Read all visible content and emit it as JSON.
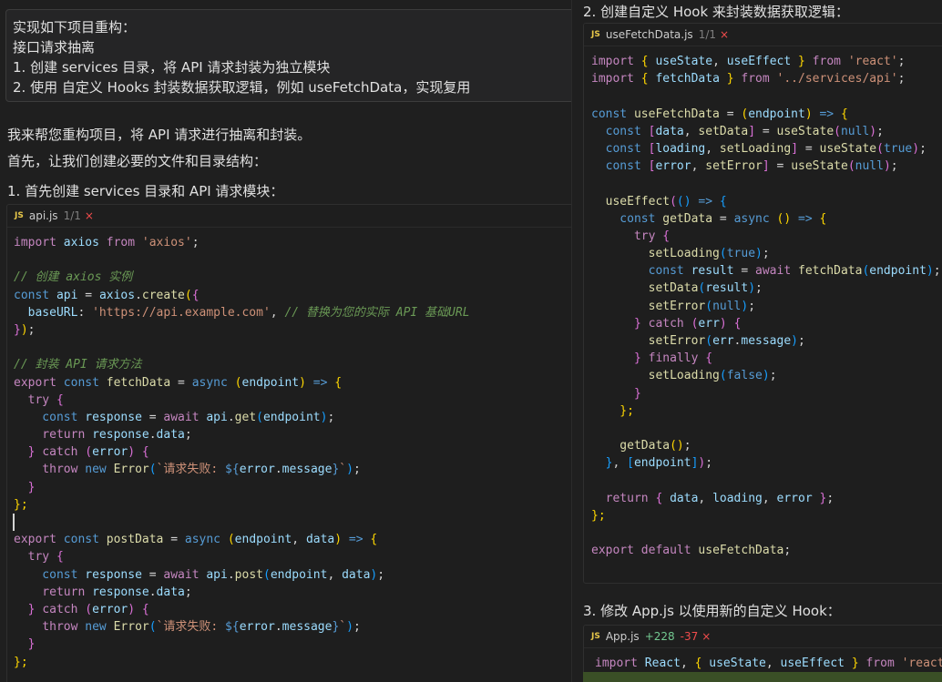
{
  "prompt": {
    "lines": [
      "实现如下项目重构：",
      "接口请求抽离",
      "1. 创建 services 目录，将 API 请求封装为独立模块",
      "2. 使用 自定义 Hooks 封装数据获取逻辑，例如 useFetchData，实现复用"
    ]
  },
  "answer": {
    "intro1": "我来帮您重构项目，将 API 请求进行抽离和封装。",
    "intro2": "首先，让我们创建必要的文件和目录结构：",
    "step1": "1. 首先创建 services 目录和 API 请求模块：",
    "step2": "2. 创建自定义 Hook 来封装数据获取逻辑：",
    "step3": "3. 修改 App.js 以使用新的自定义 Hook："
  },
  "files": {
    "api": {
      "icon": "JS",
      "name": "api.js",
      "count": "1/1",
      "close": "×"
    },
    "hook": {
      "icon": "JS",
      "name": "useFetchData.js",
      "count": "1/1",
      "close": "×"
    },
    "app": {
      "icon": "JS",
      "name": "App.js",
      "added": "+228",
      "removed": "-37",
      "close": "×"
    }
  },
  "colors": {
    "keyword": "#c586c0",
    "decl": "#569cd6",
    "variable": "#9cdcfe",
    "function": "#dcdcaa",
    "string": "#ce9178",
    "comment": "#6a9955",
    "plain": "#d4d4d4",
    "bracket1": "#ffd700",
    "bracket2": "#da70d6",
    "bracket3": "#179fff",
    "js_icon": "#e8c84a",
    "added": "#73c991",
    "removed": "#f14c4c"
  },
  "code_api": [
    [
      [
        "import ",
        "keyword"
      ],
      [
        "axios ",
        "variable"
      ],
      [
        "from ",
        "keyword"
      ],
      [
        "'axios'",
        "string"
      ],
      [
        ";",
        "plain"
      ]
    ],
    [],
    [
      [
        "// 创建 axios 实例",
        "comment"
      ]
    ],
    [
      [
        "const ",
        "decl"
      ],
      [
        "api",
        "variable"
      ],
      [
        " = ",
        "plain"
      ],
      [
        "axios",
        "variable"
      ],
      [
        ".",
        "plain"
      ],
      [
        "create",
        "function"
      ],
      [
        "(",
        "bracket1"
      ],
      [
        "{",
        "bracket2"
      ]
    ],
    [
      [
        "  baseURL",
        "variable"
      ],
      [
        ": ",
        "plain"
      ],
      [
        "'https://api.example.com'",
        "string"
      ],
      [
        ", ",
        "plain"
      ],
      [
        "// 替换为您的实际 API 基础URL",
        "comment"
      ]
    ],
    [
      [
        "}",
        "bracket2"
      ],
      [
        ")",
        "bracket1"
      ],
      [
        ";",
        "plain"
      ]
    ],
    [],
    [
      [
        "// 封装 API 请求方法",
        "comment"
      ]
    ],
    [
      [
        "export ",
        "keyword"
      ],
      [
        "const ",
        "decl"
      ],
      [
        "fetchData",
        "function"
      ],
      [
        " = ",
        "plain"
      ],
      [
        "async ",
        "decl"
      ],
      [
        "(",
        "bracket1"
      ],
      [
        "endpoint",
        "variable"
      ],
      [
        ") ",
        "bracket1"
      ],
      [
        "=> ",
        "decl"
      ],
      [
        "{",
        "bracket1"
      ]
    ],
    [
      [
        "  try ",
        "keyword"
      ],
      [
        "{",
        "bracket2"
      ]
    ],
    [
      [
        "    const ",
        "decl"
      ],
      [
        "response",
        "variable"
      ],
      [
        " = ",
        "plain"
      ],
      [
        "await ",
        "keyword"
      ],
      [
        "api",
        "variable"
      ],
      [
        ".",
        "plain"
      ],
      [
        "get",
        "function"
      ],
      [
        "(",
        "bracket3"
      ],
      [
        "endpoint",
        "variable"
      ],
      [
        ")",
        "bracket3"
      ],
      [
        ";",
        "plain"
      ]
    ],
    [
      [
        "    return ",
        "keyword"
      ],
      [
        "response",
        "variable"
      ],
      [
        ".",
        "plain"
      ],
      [
        "data",
        "variable"
      ],
      [
        ";",
        "plain"
      ]
    ],
    [
      [
        "  } ",
        "bracket2"
      ],
      [
        "catch ",
        "keyword"
      ],
      [
        "(",
        "bracket2"
      ],
      [
        "error",
        "variable"
      ],
      [
        ") ",
        "bracket2"
      ],
      [
        "{",
        "bracket2"
      ]
    ],
    [
      [
        "    throw ",
        "keyword"
      ],
      [
        "new ",
        "decl"
      ],
      [
        "Error",
        "function"
      ],
      [
        "(",
        "bracket3"
      ],
      [
        "`请求失败: ",
        "string"
      ],
      [
        "${",
        "decl"
      ],
      [
        "error",
        "variable"
      ],
      [
        ".",
        "plain"
      ],
      [
        "message",
        "variable"
      ],
      [
        "}",
        "decl"
      ],
      [
        "`",
        "string"
      ],
      [
        ")",
        "bracket3"
      ],
      [
        ";",
        "plain"
      ]
    ],
    [
      [
        "  }",
        "bracket2"
      ]
    ],
    [
      [
        "};",
        "bracket1"
      ]
    ],
    [],
    [
      [
        "export ",
        "keyword"
      ],
      [
        "const ",
        "decl"
      ],
      [
        "postData",
        "function"
      ],
      [
        " = ",
        "plain"
      ],
      [
        "async ",
        "decl"
      ],
      [
        "(",
        "bracket1"
      ],
      [
        "endpoint",
        "variable"
      ],
      [
        ", ",
        "plain"
      ],
      [
        "data",
        "variable"
      ],
      [
        ") ",
        "bracket1"
      ],
      [
        "=> ",
        "decl"
      ],
      [
        "{",
        "bracket1"
      ]
    ],
    [
      [
        "  try ",
        "keyword"
      ],
      [
        "{",
        "bracket2"
      ]
    ],
    [
      [
        "    const ",
        "decl"
      ],
      [
        "response",
        "variable"
      ],
      [
        " = ",
        "plain"
      ],
      [
        "await ",
        "keyword"
      ],
      [
        "api",
        "variable"
      ],
      [
        ".",
        "plain"
      ],
      [
        "post",
        "function"
      ],
      [
        "(",
        "bracket3"
      ],
      [
        "endpoint",
        "variable"
      ],
      [
        ", ",
        "plain"
      ],
      [
        "data",
        "variable"
      ],
      [
        ")",
        "bracket3"
      ],
      [
        ";",
        "plain"
      ]
    ],
    [
      [
        "    return ",
        "keyword"
      ],
      [
        "response",
        "variable"
      ],
      [
        ".",
        "plain"
      ],
      [
        "data",
        "variable"
      ],
      [
        ";",
        "plain"
      ]
    ],
    [
      [
        "  } ",
        "bracket2"
      ],
      [
        "catch ",
        "keyword"
      ],
      [
        "(",
        "bracket2"
      ],
      [
        "error",
        "variable"
      ],
      [
        ") ",
        "bracket2"
      ],
      [
        "{",
        "bracket2"
      ]
    ],
    [
      [
        "    throw ",
        "keyword"
      ],
      [
        "new ",
        "decl"
      ],
      [
        "Error",
        "function"
      ],
      [
        "(",
        "bracket3"
      ],
      [
        "`请求失败: ",
        "string"
      ],
      [
        "${",
        "decl"
      ],
      [
        "error",
        "variable"
      ],
      [
        ".",
        "plain"
      ],
      [
        "message",
        "variable"
      ],
      [
        "}",
        "decl"
      ],
      [
        "`",
        "string"
      ],
      [
        ")",
        "bracket3"
      ],
      [
        ";",
        "plain"
      ]
    ],
    [
      [
        "  }",
        "bracket2"
      ]
    ],
    [
      [
        "};",
        "bracket1"
      ]
    ]
  ],
  "code_hook": [
    [
      [
        "import ",
        "keyword"
      ],
      [
        "{ ",
        "bracket1"
      ],
      [
        "useState",
        "variable"
      ],
      [
        ", ",
        "plain"
      ],
      [
        "useEffect ",
        "variable"
      ],
      [
        "} ",
        "bracket1"
      ],
      [
        "from ",
        "keyword"
      ],
      [
        "'react'",
        "string"
      ],
      [
        ";",
        "plain"
      ]
    ],
    [
      [
        "import ",
        "keyword"
      ],
      [
        "{ ",
        "bracket1"
      ],
      [
        "fetchData ",
        "variable"
      ],
      [
        "} ",
        "bracket1"
      ],
      [
        "from ",
        "keyword"
      ],
      [
        "'../services/api'",
        "string"
      ],
      [
        ";",
        "plain"
      ]
    ],
    [],
    [
      [
        "const ",
        "decl"
      ],
      [
        "useFetchData",
        "function"
      ],
      [
        " = ",
        "plain"
      ],
      [
        "(",
        "bracket1"
      ],
      [
        "endpoint",
        "variable"
      ],
      [
        ") ",
        "bracket1"
      ],
      [
        "=> ",
        "decl"
      ],
      [
        "{",
        "bracket1"
      ]
    ],
    [
      [
        "  const ",
        "decl"
      ],
      [
        "[",
        "bracket2"
      ],
      [
        "data",
        "variable"
      ],
      [
        ", ",
        "plain"
      ],
      [
        "setData",
        "function"
      ],
      [
        "]",
        "bracket2"
      ],
      [
        " = ",
        "plain"
      ],
      [
        "useState",
        "function"
      ],
      [
        "(",
        "bracket2"
      ],
      [
        "null",
        "decl"
      ],
      [
        ")",
        "bracket2"
      ],
      [
        ";",
        "plain"
      ]
    ],
    [
      [
        "  const ",
        "decl"
      ],
      [
        "[",
        "bracket2"
      ],
      [
        "loading",
        "variable"
      ],
      [
        ", ",
        "plain"
      ],
      [
        "setLoading",
        "function"
      ],
      [
        "]",
        "bracket2"
      ],
      [
        " = ",
        "plain"
      ],
      [
        "useState",
        "function"
      ],
      [
        "(",
        "bracket2"
      ],
      [
        "true",
        "decl"
      ],
      [
        ")",
        "bracket2"
      ],
      [
        ";",
        "plain"
      ]
    ],
    [
      [
        "  const ",
        "decl"
      ],
      [
        "[",
        "bracket2"
      ],
      [
        "error",
        "variable"
      ],
      [
        ", ",
        "plain"
      ],
      [
        "setError",
        "function"
      ],
      [
        "]",
        "bracket2"
      ],
      [
        " = ",
        "plain"
      ],
      [
        "useState",
        "function"
      ],
      [
        "(",
        "bracket2"
      ],
      [
        "null",
        "decl"
      ],
      [
        ")",
        "bracket2"
      ],
      [
        ";",
        "plain"
      ]
    ],
    [],
    [
      [
        "  useEffect",
        "function"
      ],
      [
        "(",
        "bracket2"
      ],
      [
        "(",
        "bracket3"
      ],
      [
        ") ",
        "bracket3"
      ],
      [
        "=> ",
        "decl"
      ],
      [
        "{",
        "bracket3"
      ]
    ],
    [
      [
        "    const ",
        "decl"
      ],
      [
        "getData",
        "function"
      ],
      [
        " = ",
        "plain"
      ],
      [
        "async ",
        "decl"
      ],
      [
        "(",
        "bracket1"
      ],
      [
        ") ",
        "bracket1"
      ],
      [
        "=> ",
        "decl"
      ],
      [
        "{",
        "bracket1"
      ]
    ],
    [
      [
        "      try ",
        "keyword"
      ],
      [
        "{",
        "bracket2"
      ]
    ],
    [
      [
        "        setLoading",
        "function"
      ],
      [
        "(",
        "bracket3"
      ],
      [
        "true",
        "decl"
      ],
      [
        ")",
        "bracket3"
      ],
      [
        ";",
        "plain"
      ]
    ],
    [
      [
        "        const ",
        "decl"
      ],
      [
        "result",
        "variable"
      ],
      [
        " = ",
        "plain"
      ],
      [
        "await ",
        "keyword"
      ],
      [
        "fetchData",
        "function"
      ],
      [
        "(",
        "bracket3"
      ],
      [
        "endpoint",
        "variable"
      ],
      [
        ")",
        "bracket3"
      ],
      [
        ";",
        "plain"
      ]
    ],
    [
      [
        "        setData",
        "function"
      ],
      [
        "(",
        "bracket3"
      ],
      [
        "result",
        "variable"
      ],
      [
        ")",
        "bracket3"
      ],
      [
        ";",
        "plain"
      ]
    ],
    [
      [
        "        setError",
        "function"
      ],
      [
        "(",
        "bracket3"
      ],
      [
        "null",
        "decl"
      ],
      [
        ")",
        "bracket3"
      ],
      [
        ";",
        "plain"
      ]
    ],
    [
      [
        "      } ",
        "bracket2"
      ],
      [
        "catch ",
        "keyword"
      ],
      [
        "(",
        "bracket2"
      ],
      [
        "err",
        "variable"
      ],
      [
        ") ",
        "bracket2"
      ],
      [
        "{",
        "bracket2"
      ]
    ],
    [
      [
        "        setError",
        "function"
      ],
      [
        "(",
        "bracket3"
      ],
      [
        "err",
        "variable"
      ],
      [
        ".",
        "plain"
      ],
      [
        "message",
        "variable"
      ],
      [
        ")",
        "bracket3"
      ],
      [
        ";",
        "plain"
      ]
    ],
    [
      [
        "      } ",
        "bracket2"
      ],
      [
        "finally ",
        "keyword"
      ],
      [
        "{",
        "bracket2"
      ]
    ],
    [
      [
        "        setLoading",
        "function"
      ],
      [
        "(",
        "bracket3"
      ],
      [
        "false",
        "decl"
      ],
      [
        ")",
        "bracket3"
      ],
      [
        ";",
        "plain"
      ]
    ],
    [
      [
        "      }",
        "bracket2"
      ]
    ],
    [
      [
        "    };",
        "bracket1"
      ]
    ],
    [],
    [
      [
        "    getData",
        "function"
      ],
      [
        "()",
        "bracket1"
      ],
      [
        ";",
        "plain"
      ]
    ],
    [
      [
        "  }",
        "bracket3"
      ],
      [
        ", ",
        "plain"
      ],
      [
        "[",
        "bracket3"
      ],
      [
        "endpoint",
        "variable"
      ],
      [
        "]",
        "bracket3"
      ],
      [
        ")",
        "bracket2"
      ],
      [
        ";",
        "plain"
      ]
    ],
    [],
    [
      [
        "  return ",
        "keyword"
      ],
      [
        "{ ",
        "bracket2"
      ],
      [
        "data",
        "variable"
      ],
      [
        ", ",
        "plain"
      ],
      [
        "loading",
        "variable"
      ],
      [
        ", ",
        "plain"
      ],
      [
        "error ",
        "variable"
      ],
      [
        "}",
        "bracket2"
      ],
      [
        ";",
        "plain"
      ]
    ],
    [
      [
        "};",
        "bracket1"
      ]
    ],
    [],
    [
      [
        "export ",
        "keyword"
      ],
      [
        "default ",
        "keyword"
      ],
      [
        "useFetchData",
        "function"
      ],
      [
        ";",
        "plain"
      ]
    ]
  ],
  "code_app": [
    [
      [
        "import ",
        "keyword"
      ],
      [
        "React",
        "variable"
      ],
      [
        ", ",
        "plain"
      ],
      [
        "{ ",
        "bracket1"
      ],
      [
        "useState",
        "variable"
      ],
      [
        ", ",
        "plain"
      ],
      [
        "useEffect ",
        "variable"
      ],
      [
        "} ",
        "bracket1"
      ],
      [
        "from ",
        "keyword"
      ],
      [
        "'react'",
        "string"
      ]
    ]
  ]
}
